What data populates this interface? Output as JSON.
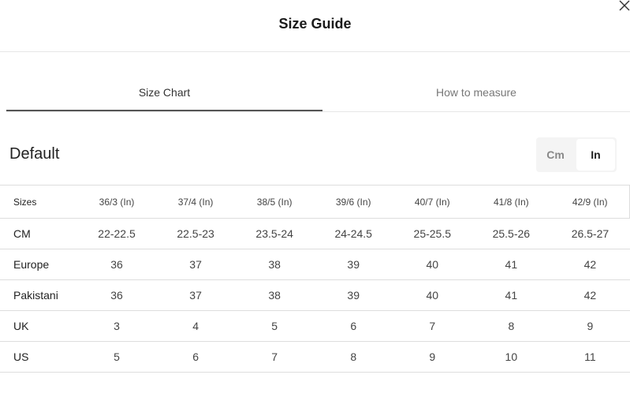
{
  "modal": {
    "title": "Size Guide",
    "close_icon": "close-icon"
  },
  "tabs": [
    {
      "label": "Size Chart",
      "active": true
    },
    {
      "label": "How to measure",
      "active": false
    }
  ],
  "section": {
    "title": "Default"
  },
  "units": {
    "options": [
      "Cm",
      "In"
    ],
    "selected": "In"
  },
  "table": {
    "headers": [
      "Sizes",
      "36/3 (In)",
      "37/4 (In)",
      "38/5 (In)",
      "39/6 (In)",
      "40/7 (In)",
      "41/8 (In)",
      "42/9 (In)"
    ],
    "rows": [
      [
        "CM",
        "22-22.5",
        "22.5-23",
        "23.5-24",
        "24-24.5",
        "25-25.5",
        "25.5-26",
        "26.5-27"
      ],
      [
        "Europe",
        "36",
        "37",
        "38",
        "39",
        "40",
        "41",
        "42"
      ],
      [
        "Pakistani",
        "36",
        "37",
        "38",
        "39",
        "40",
        "41",
        "42"
      ],
      [
        "UK",
        "3",
        "4",
        "5",
        "6",
        "7",
        "8",
        "9"
      ],
      [
        "US",
        "5",
        "6",
        "7",
        "8",
        "9",
        "10",
        "11"
      ]
    ]
  }
}
